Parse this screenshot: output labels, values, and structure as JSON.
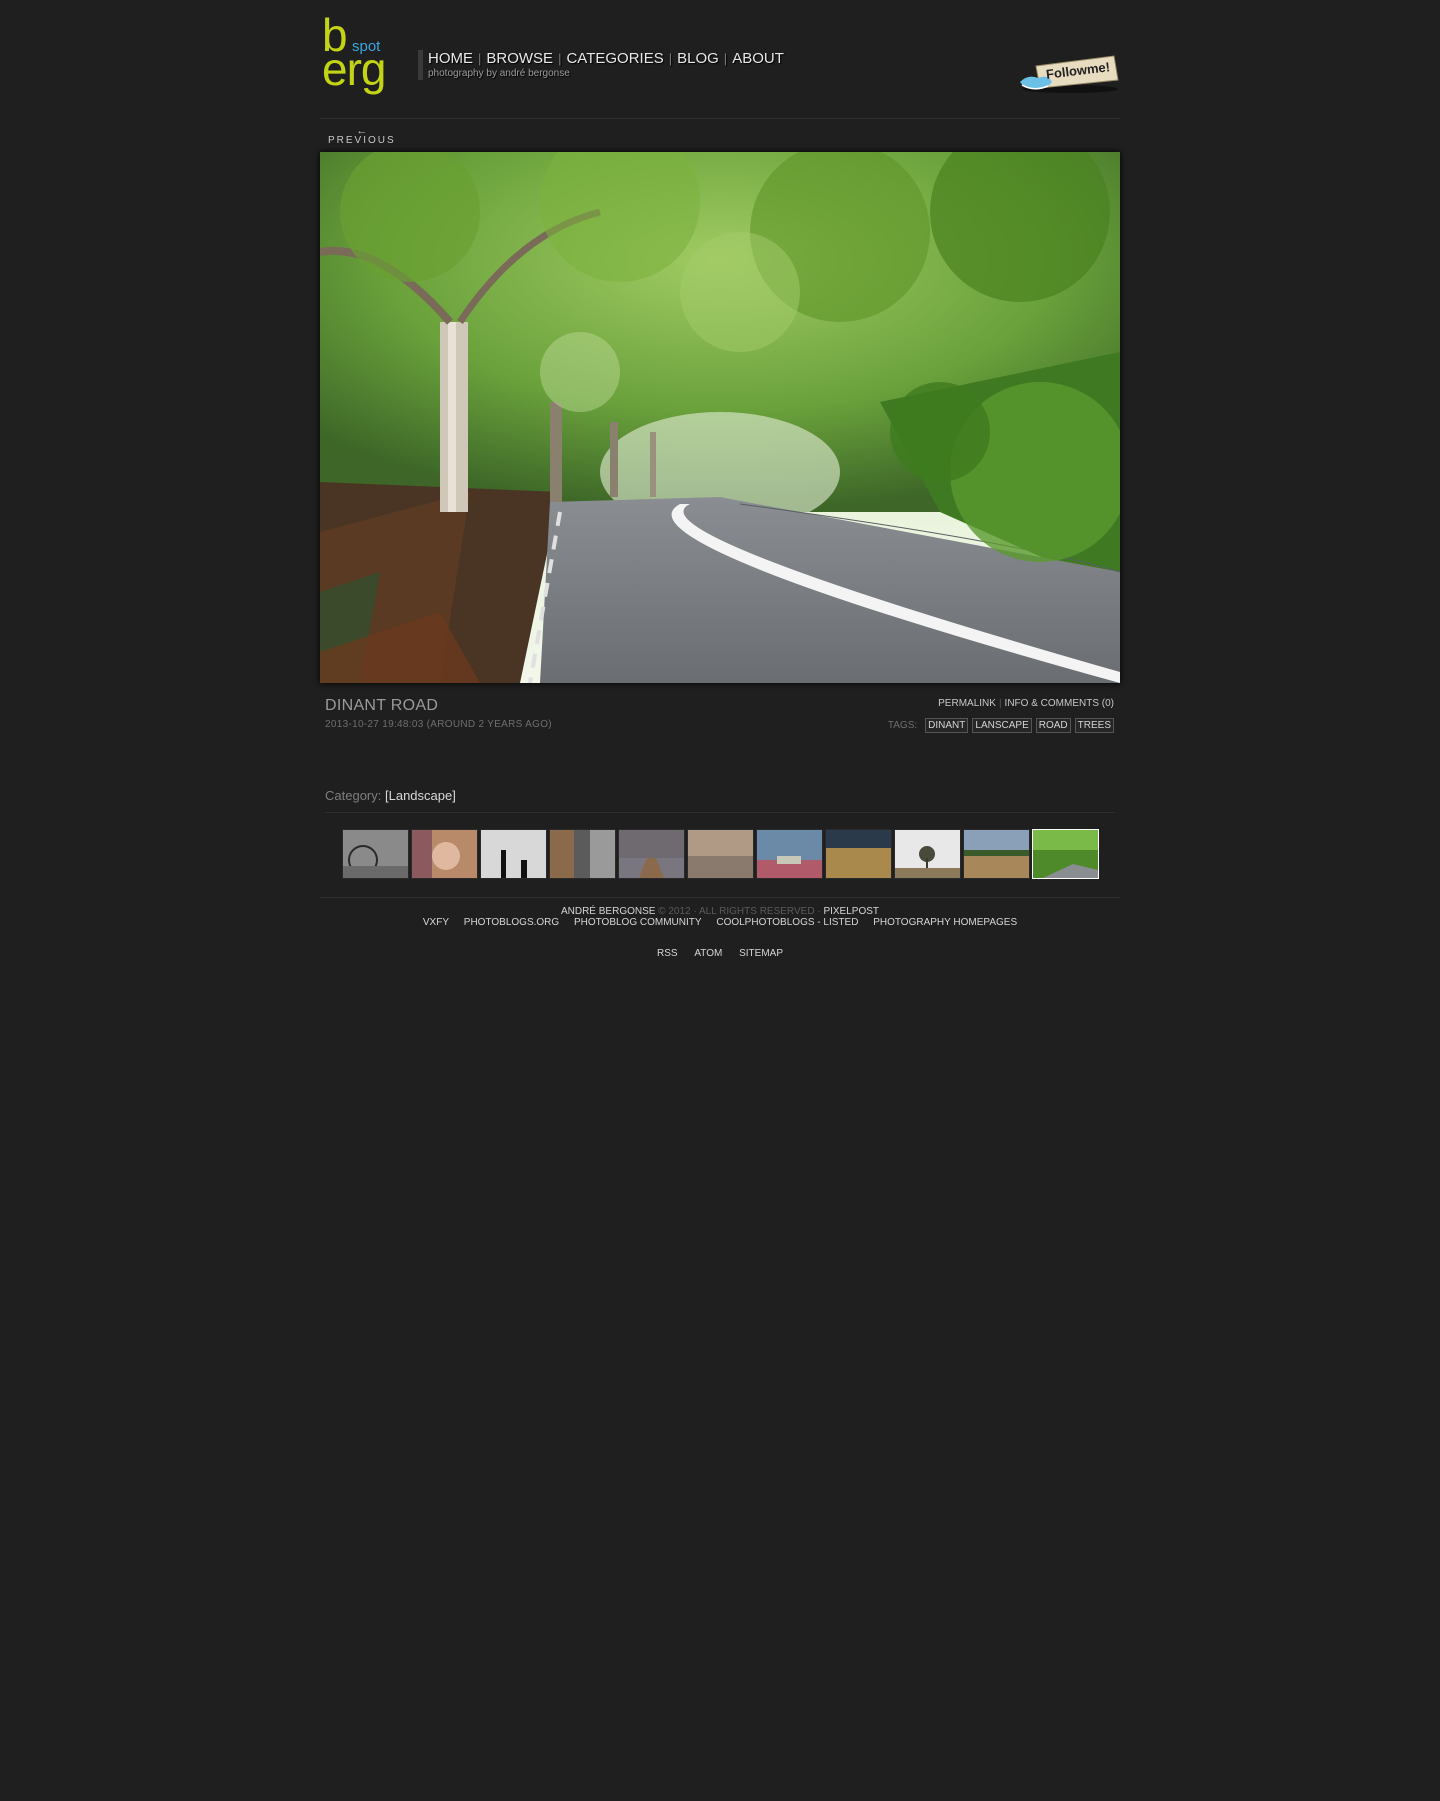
{
  "logo": {
    "b": "b",
    "spot": "spot",
    "erg": "erg"
  },
  "nav": {
    "items": [
      "HOME",
      "BROWSE",
      "CATEGORIES",
      "BLOG",
      "ABOUT"
    ],
    "tagline": "photography by andré bergonse"
  },
  "follow": {
    "text": "Followme!"
  },
  "previous": {
    "arrow": "←",
    "label": "PREVIOUS"
  },
  "photo": {
    "title": "DINANT ROAD",
    "date": "2013-10-27 19:48:03 (AROUND 2 YEARS AGO)",
    "permalink": "PERMALINK",
    "comments": "INFO & COMMENTS (0)",
    "tags_label": "TAGS:",
    "tags": [
      "DINANT",
      "LANSCAPE",
      "ROAD",
      "TREES"
    ]
  },
  "category": {
    "label": "Category:",
    "value": "[Landscape]"
  },
  "thumbnails": {
    "count": 11,
    "active_index": 10,
    "colors": [
      "#8a8a8a",
      "#b88a6a",
      "#d8d8d8",
      "#5b5b5b",
      "#6e6a70",
      "#b09a86",
      "#6a8aa8",
      "#a98a4c",
      "#e8e8e8",
      "#8aa0b8",
      "#4e8a2a"
    ]
  },
  "footer": {
    "author": "ANDRÉ BERGONSE",
    "copyright": "© 2012 · ALL RIGHTS RESERVED ·",
    "engine": "PIXELPOST",
    "links": [
      "VXFY",
      "PHOTOBLOGS.ORG",
      "PHOTOBLOG COMMUNITY",
      "COOLPHOTOBLOGS - LISTED",
      "PHOTOGRAPHY HOMEPAGES"
    ],
    "feeds": [
      "RSS",
      "ATOM",
      "SITEMAP"
    ]
  },
  "colors": {
    "accent_green": "#c3d414",
    "accent_blue": "#3ba6e0",
    "background": "#1f1f1f"
  }
}
